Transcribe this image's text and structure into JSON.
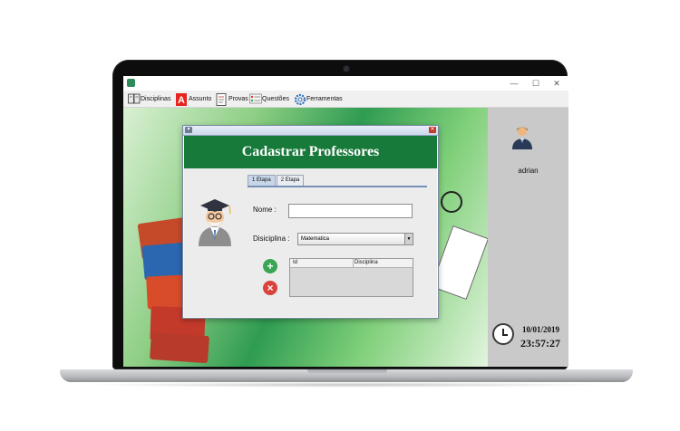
{
  "window": {
    "minimize": "—",
    "maximize": "☐",
    "close": "✕"
  },
  "menu": {
    "items": [
      {
        "label": "Disciplinas",
        "icon": "book-icon"
      },
      {
        "label": "Assunto",
        "icon": "letter-a-icon"
      },
      {
        "label": "Provas",
        "icon": "exam-icon"
      },
      {
        "label": "Questões",
        "icon": "questions-icon"
      },
      {
        "label": "Ferramentas",
        "icon": "gear-icon"
      }
    ]
  },
  "frame": {
    "title": "Cadastrar Professores",
    "tabs": [
      "1 Etapa",
      "2 Etapa"
    ],
    "nome_label": "Nome :",
    "nome_value": "",
    "disciplina_label": "Disiciplina :",
    "disciplina_value": "Matematica",
    "table": {
      "columns": [
        "Id",
        "Disciplina"
      ]
    }
  },
  "side": {
    "username": "adrian",
    "date": "10/01/2019",
    "time": "23:57:27"
  },
  "colors": {
    "header_green": "#187a3a",
    "add_green": "#3aa655",
    "remove_red": "#d9433b"
  }
}
